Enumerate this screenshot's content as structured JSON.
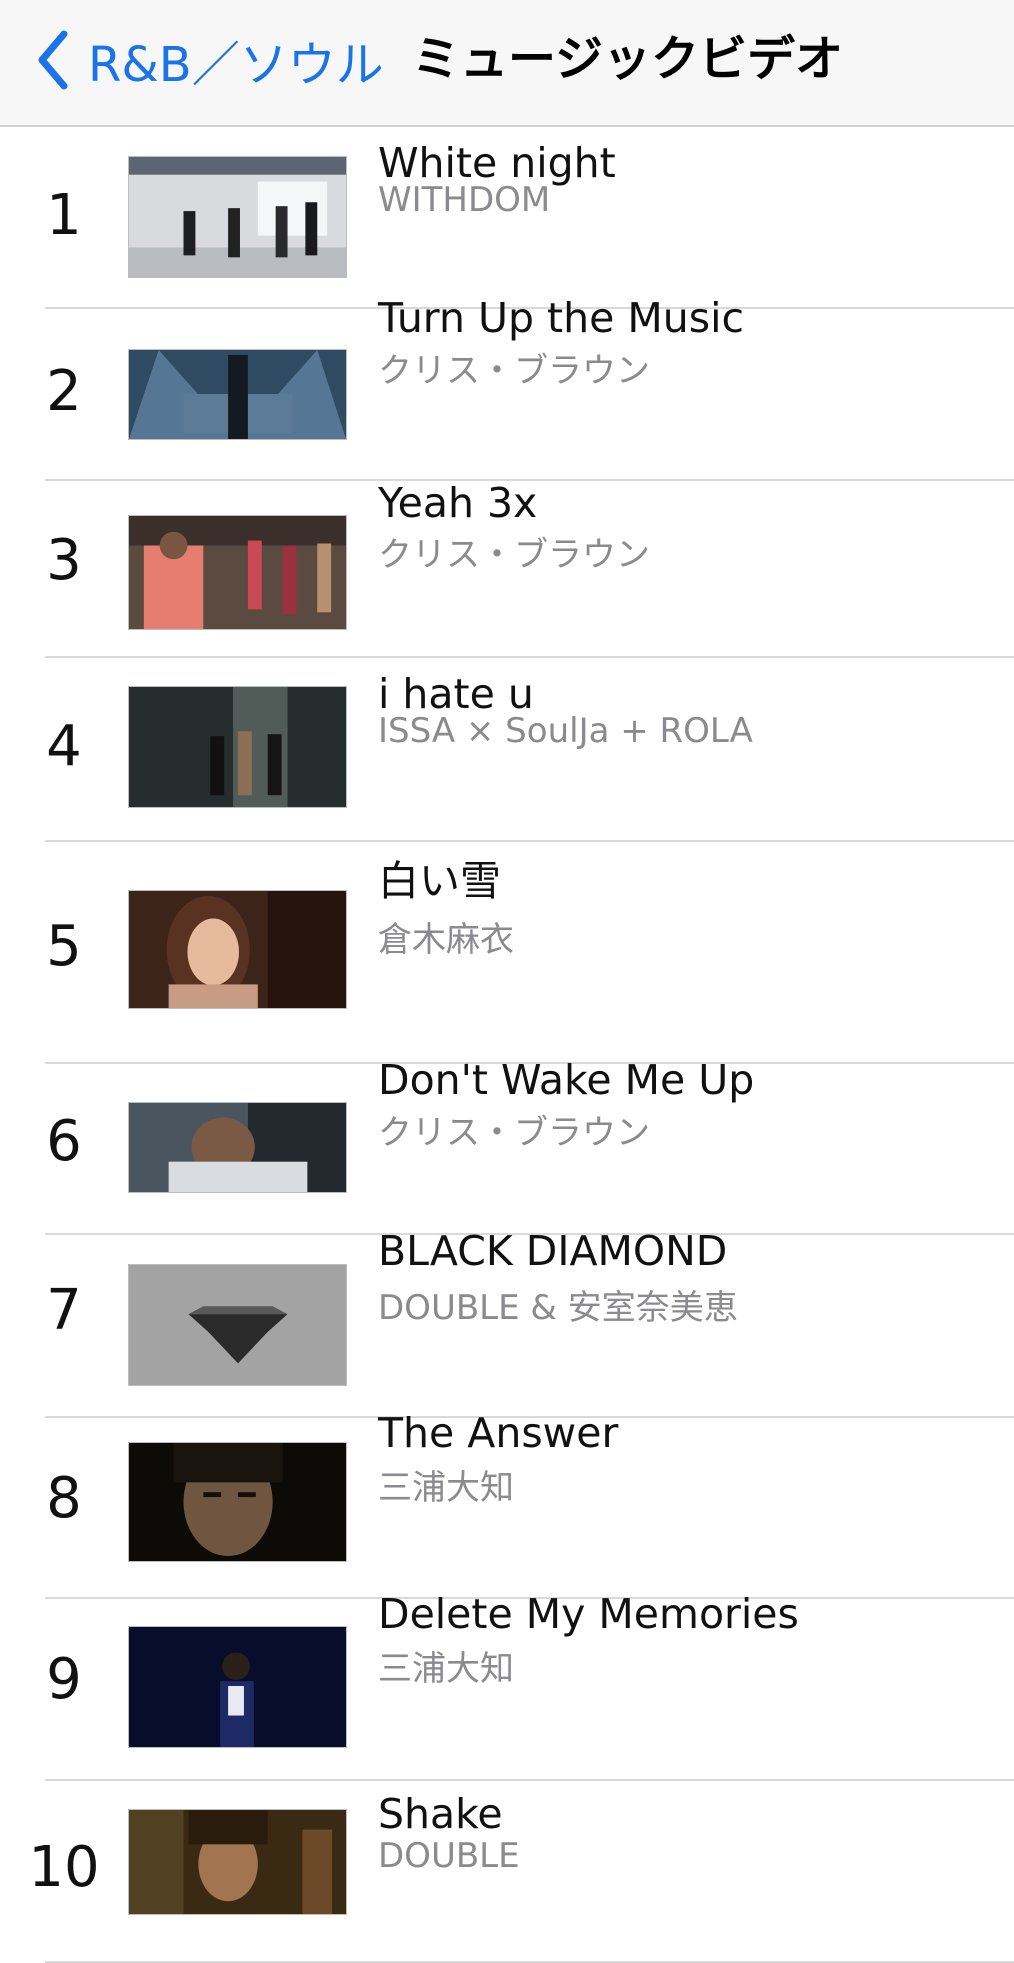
{
  "nav": {
    "back_label": "R&B／ソウル",
    "title": "ミュージックビデオ",
    "accent": "#1a73e8"
  },
  "videos": [
    {
      "rank": "1",
      "title": "White night",
      "artist": "WITHDOM"
    },
    {
      "rank": "2",
      "title": "Turn Up the Music",
      "artist": "クリス・ブラウン"
    },
    {
      "rank": "3",
      "title": "Yeah 3x",
      "artist": "クリス・ブラウン"
    },
    {
      "rank": "4",
      "title": "i hate u",
      "artist": "ISSA × SoulJa + ROLA"
    },
    {
      "rank": "5",
      "title": "白い雪",
      "artist": "倉木麻衣"
    },
    {
      "rank": "6",
      "title": "Don't Wake Me Up",
      "artist": "クリス・ブラウン"
    },
    {
      "rank": "7",
      "title": "BLACK DIAMOND",
      "artist": "DOUBLE & 安室奈美恵"
    },
    {
      "rank": "8",
      "title": "The Answer",
      "artist": "三浦大知"
    },
    {
      "rank": "9",
      "title": "Delete My Memories",
      "artist": "三浦大知"
    },
    {
      "rank": "10",
      "title": "Shake",
      "artist": "DOUBLE"
    }
  ]
}
